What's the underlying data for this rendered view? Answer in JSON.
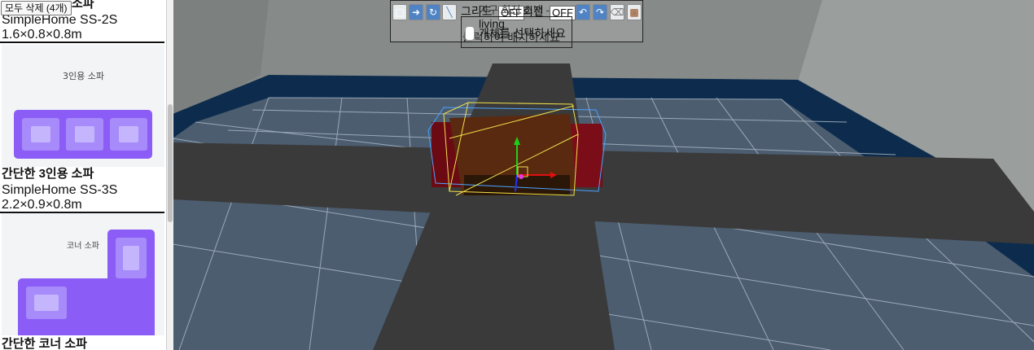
{
  "sidebar": {
    "delete_all_label": "모두 삭제 (4개)",
    "cards": [
      {
        "name": "소파",
        "model": "SimpleHome SS-2S",
        "dims": "1.6×0.8×0.8m"
      },
      {
        "thumb_label": "3인용 소파",
        "name": "간단한 3인용 소파",
        "model": "SimpleHome SS-3S",
        "dims": "2.2×0.9×0.8m"
      },
      {
        "thumb_label": "코너 소파",
        "name": "간단한 코너 소파"
      }
    ]
  },
  "toolbar": {
    "grid_label": "그리드",
    "grid_state": "OFF",
    "snap_label": "회전",
    "snap_state": "OFF",
    "room_label": "living",
    "hint_select": "개체를 선택하세요",
    "hint_place": "클릭하여 배치하세요",
    "hint_extra": "가구 회전 스냅 -"
  },
  "colors": {
    "accent": "#8b5cf6",
    "floor": "#4c5d70",
    "path": "#3a3a3a",
    "wall": "#8a8e8c"
  }
}
